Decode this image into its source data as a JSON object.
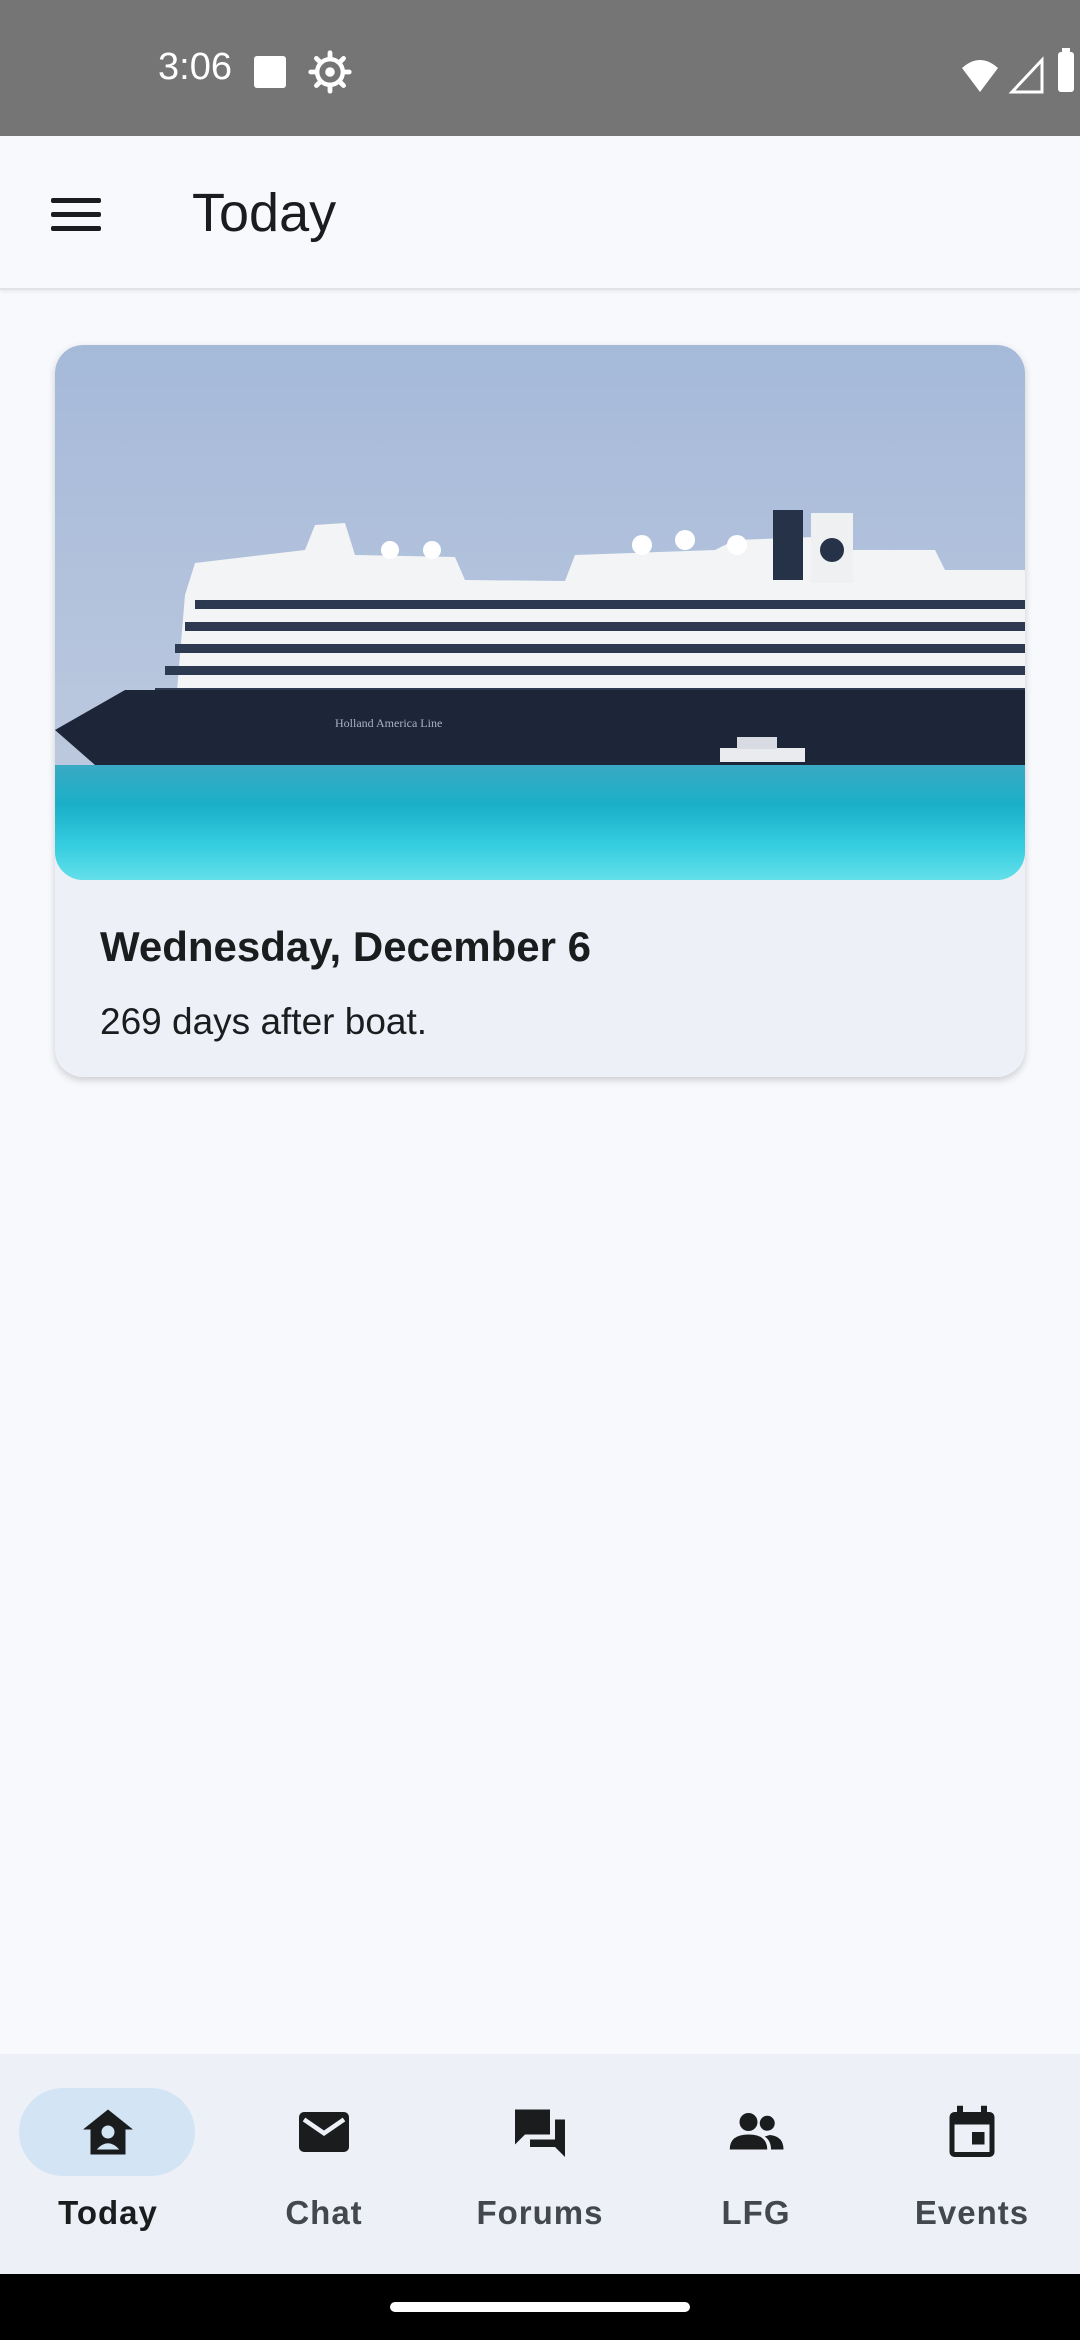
{
  "status_bar": {
    "time": "3:06",
    "icons": [
      "stop-square-icon",
      "gear-icon",
      "wifi-icon",
      "signal-icon",
      "battery-icon"
    ]
  },
  "app_bar": {
    "menu_icon": "hamburger-menu-icon",
    "title": "Today"
  },
  "card": {
    "image": "cruise-ship-photo",
    "image_ship_text": "Holland America Line",
    "title": "Wednesday, December 6",
    "subtitle": "269 days after boat."
  },
  "bottom_nav": {
    "items": [
      {
        "label": "Today",
        "icon": "home-person-icon",
        "active": true
      },
      {
        "label": "Chat",
        "icon": "mail-icon",
        "active": false
      },
      {
        "label": "Forums",
        "icon": "forum-icon",
        "active": false
      },
      {
        "label": "LFG",
        "icon": "group-icon",
        "active": false
      },
      {
        "label": "Events",
        "icon": "calendar-icon",
        "active": false
      }
    ]
  },
  "colors": {
    "status_bar": "#757575",
    "background": "#f8f9fd",
    "card_bg": "#edf1f7",
    "nav_bg": "#edf1f7",
    "active_pill": "#d3e4f5"
  }
}
